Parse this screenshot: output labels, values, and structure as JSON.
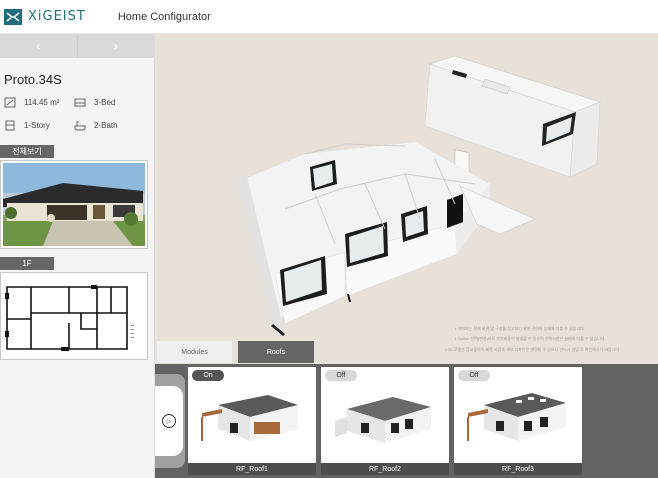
{
  "header": {
    "brand": "XiGEIST",
    "title": "Home Configurator"
  },
  "nav": {
    "prev": "‹",
    "next": "›"
  },
  "model": {
    "name": "Proto.34S",
    "specs": [
      {
        "icon": "area-icon",
        "label": "114.45 m²"
      },
      {
        "icon": "bed-icon",
        "label": "3-Bed"
      },
      {
        "icon": "story-icon",
        "label": "1-Story"
      },
      {
        "icon": "bath-icon",
        "label": "2-Bath"
      }
    ]
  },
  "sections": {
    "overview": "전체보기",
    "floor": "1F"
  },
  "tabs": {
    "modules": "Modules",
    "roofs": "Roofs"
  },
  "viewport_notes": [
    "• 이미지는 전체 외관 및 구성을 참고하기 위한 것이며 실제와 다를 수 있습니다.",
    "• Option 선택(변경)으로 추가비용이 발생할 수 있으며 선택사항은 실제와 다를 수 있습니다.",
    "• 3D 모델은 참고용이며 제품 사양과 세부 디자인은 변경될 수 있으니 반드시 상담 후 확인하시기 바랍니다."
  ],
  "roofs": [
    {
      "name": "RF_Roof1",
      "state": "On"
    },
    {
      "name": "RF_Roof2",
      "state": "Off"
    },
    {
      "name": "RF_Roof3",
      "state": "Off"
    }
  ],
  "colors": {
    "brand": "#1f6e7d",
    "viewport": "#e7e1d9",
    "panel": "#636363",
    "active_tab": "#666666"
  }
}
